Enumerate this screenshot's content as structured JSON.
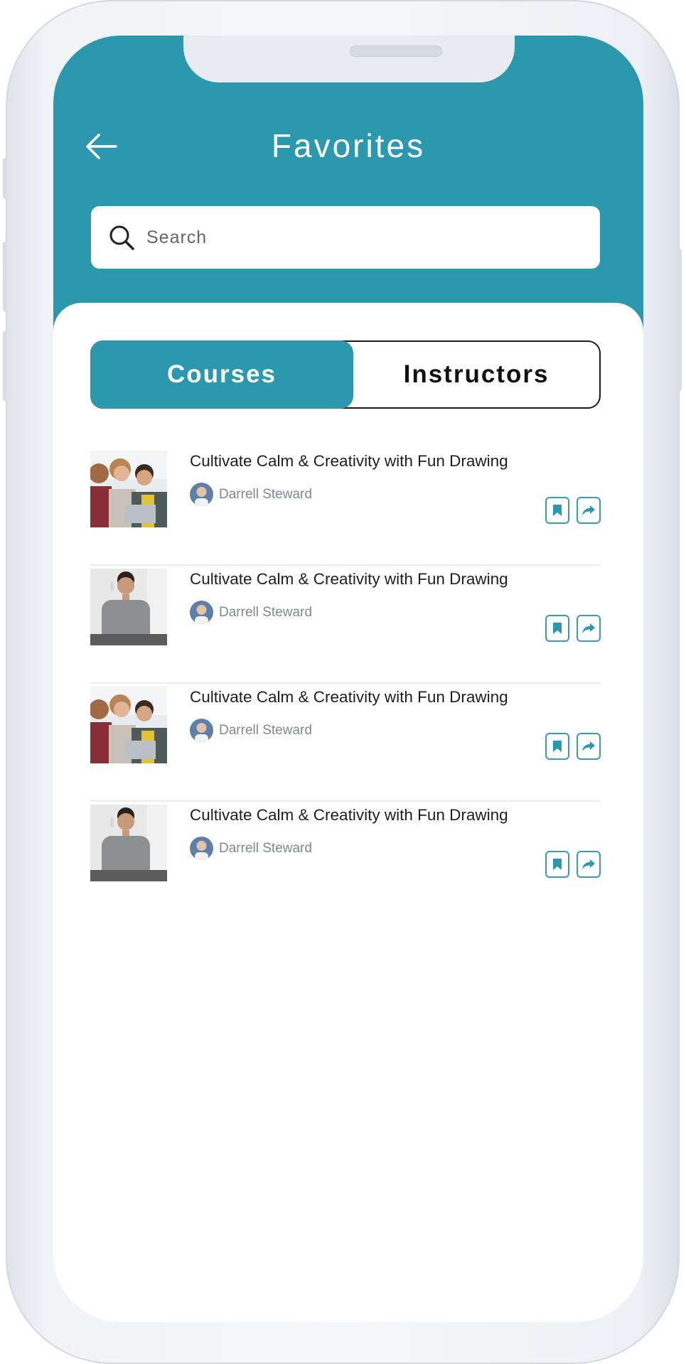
{
  "header": {
    "title": "Favorites",
    "back_icon": "arrow-left-icon"
  },
  "search": {
    "placeholder": "Search",
    "value": "",
    "icon": "search-icon"
  },
  "tabs": [
    {
      "label": "Courses",
      "active": true
    },
    {
      "label": "Instructors",
      "active": false
    }
  ],
  "courses": [
    {
      "title": "Cultivate Calm & Creativity with Fun Drawing",
      "author": "Darrell Steward",
      "thumbnail": "group-photo"
    },
    {
      "title": "Cultivate Calm & Creativity with Fun Drawing",
      "author": "Darrell Steward",
      "thumbnail": "man-photo"
    },
    {
      "title": "Cultivate Calm & Creativity with Fun Drawing",
      "author": "Darrell Steward",
      "thumbnail": "group-photo"
    },
    {
      "title": "Cultivate Calm & Creativity with Fun Drawing",
      "author": "Darrell Steward",
      "thumbnail": "man-photo"
    }
  ],
  "colors": {
    "accent": "#2c98ad",
    "text": "#1e1e1e",
    "muted": "#808890"
  }
}
